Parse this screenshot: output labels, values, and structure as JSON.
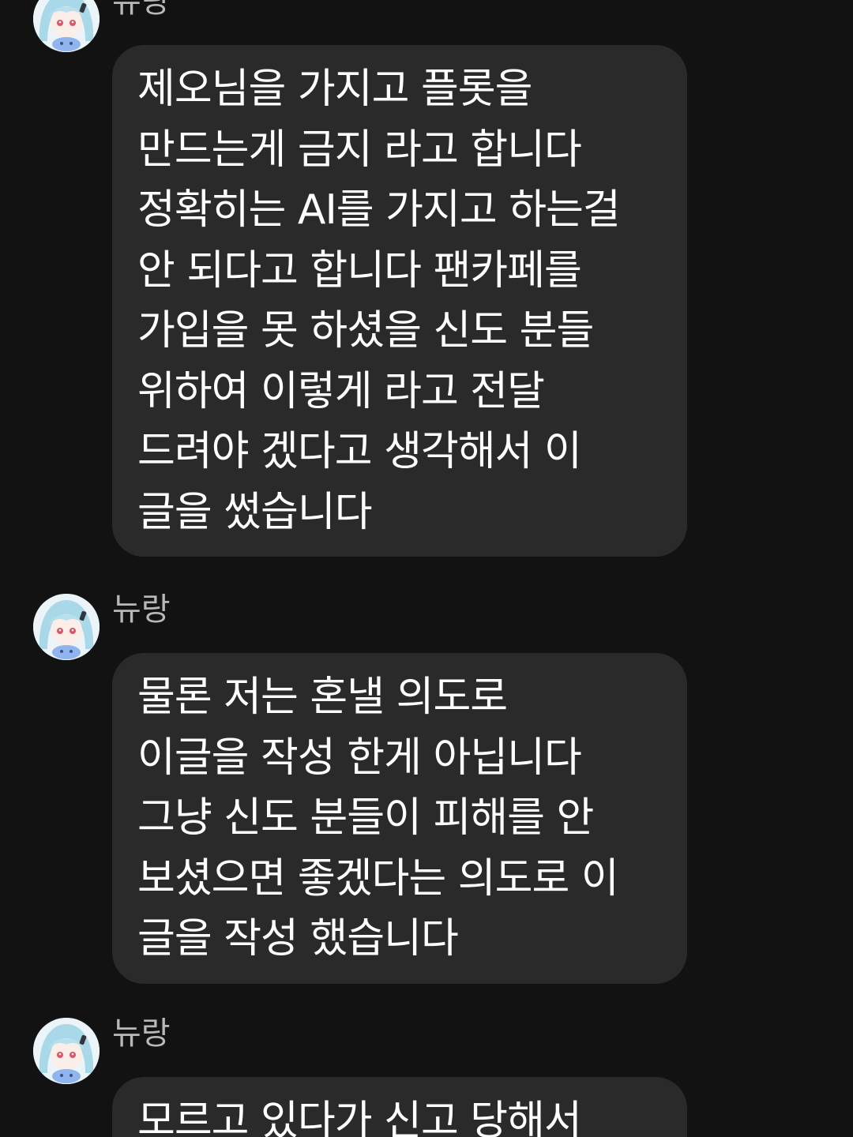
{
  "messages": [
    {
      "sender": "뉴랑",
      "lines": [
        "제오님을 가지고 플롯을",
        "만드는게 금지 라고 합니다",
        "정확히는 AI를 가지고 하는걸",
        "안 되다고 합니다 팬카페를",
        "가입을 못 하셨을 신도 분들",
        "위하여 이렇게 라고 전달",
        "드려야 겠다고 생각해서 이",
        "글을 썼습니다"
      ]
    },
    {
      "sender": "뉴랑",
      "lines": [
        "물론 저는 혼낼 의도로",
        "이글을 작성 한게 아닙니다",
        "그냥 신도 분들이 피해를 안",
        "보셨으면 좋겠다는 의도로 이",
        "글을 작성 했습니다"
      ]
    },
    {
      "sender": "뉴랑",
      "lines": [
        "모르고 있다가 신고 당해서"
      ]
    }
  ],
  "colors": {
    "background": "#121212",
    "bubble": "#2a2a2a",
    "sender_name": "#b8b8b8",
    "message_text": "#ffffff"
  },
  "icons": {
    "avatar": "anime-girl-avatar"
  }
}
